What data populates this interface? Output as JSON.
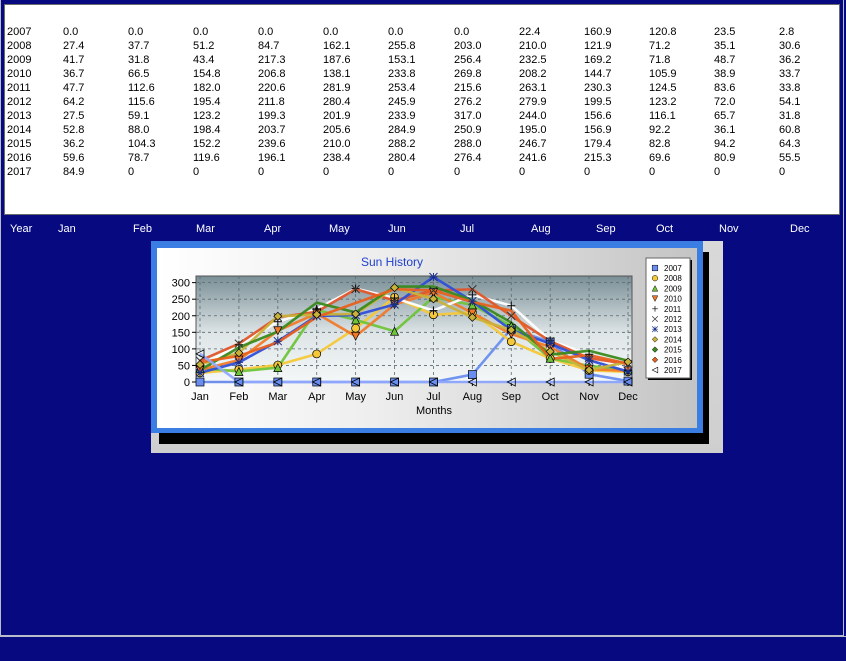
{
  "table": {
    "rows": [
      {
        "year": "2007",
        "values": [
          "0.0",
          "0.0",
          "0.0",
          "0.0",
          "0.0",
          "0.0",
          "0.0",
          "22.4",
          "160.9",
          "120.8",
          "23.5",
          "2.8"
        ]
      },
      {
        "year": "2008",
        "values": [
          "27.4",
          "37.7",
          "51.2",
          "84.7",
          "162.1",
          "255.8",
          "203.0",
          "210.0",
          "121.9",
          "71.2",
          "35.1",
          "30.6"
        ]
      },
      {
        "year": "2009",
        "values": [
          "41.7",
          "31.8",
          "43.4",
          "217.3",
          "187.6",
          "153.1",
          "256.4",
          "232.5",
          "169.2",
          "71.8",
          "48.7",
          "36.2"
        ]
      },
      {
        "year": "2010",
        "values": [
          "36.7",
          "66.5",
          "154.8",
          "206.8",
          "138.1",
          "233.8",
          "269.8",
          "208.2",
          "144.7",
          "105.9",
          "38.9",
          "33.7"
        ]
      },
      {
        "year": "2011",
        "values": [
          "47.7",
          "112.6",
          "182.0",
          "220.6",
          "281.9",
          "253.4",
          "215.6",
          "263.1",
          "230.3",
          "124.5",
          "83.6",
          "33.8"
        ]
      },
      {
        "year": "2012",
        "values": [
          "64.2",
          "115.6",
          "195.4",
          "211.8",
          "280.4",
          "245.9",
          "276.2",
          "279.9",
          "199.5",
          "123.2",
          "72.0",
          "54.1"
        ]
      },
      {
        "year": "2013",
        "values": [
          "27.5",
          "59.1",
          "123.2",
          "199.3",
          "201.9",
          "233.9",
          "317.0",
          "244.0",
          "156.6",
          "116.1",
          "65.7",
          "31.8"
        ]
      },
      {
        "year": "2014",
        "values": [
          "52.8",
          "88.0",
          "198.4",
          "203.7",
          "205.6",
          "284.9",
          "250.9",
          "195.0",
          "156.9",
          "92.2",
          "36.1",
          "60.8"
        ]
      },
      {
        "year": "2015",
        "values": [
          "36.2",
          "104.3",
          "152.2",
          "239.6",
          "210.0",
          "288.2",
          "288.0",
          "246.7",
          "179.4",
          "82.8",
          "94.2",
          "64.3"
        ]
      },
      {
        "year": "2016",
        "values": [
          "59.6",
          "78.7",
          "119.6",
          "196.1",
          "238.4",
          "280.4",
          "276.4",
          "241.6",
          "215.3",
          "69.6",
          "80.9",
          "55.5"
        ]
      },
      {
        "year": "2017",
        "values": [
          "84.9",
          "0",
          "0",
          "0",
          "0",
          "0",
          "0",
          "0",
          "0",
          "0",
          "0",
          "0"
        ]
      }
    ]
  },
  "header": {
    "year": "Year",
    "months": [
      "Jan",
      "Feb",
      "Mar",
      "Apr",
      "May",
      "Jun",
      "Jul",
      "Aug",
      "Sep",
      "Oct",
      "Nov",
      "Dec"
    ]
  },
  "chart_data": {
    "type": "line",
    "title": "Sun History",
    "xlabel": "Months",
    "ylabel": "",
    "categories": [
      "Jan",
      "Feb",
      "Mar",
      "Apr",
      "May",
      "Jun",
      "Jul",
      "Aug",
      "Sep",
      "Oct",
      "Nov",
      "Dec"
    ],
    "ylim": [
      0,
      320
    ],
    "yticks": [
      0,
      50,
      100,
      150,
      200,
      250,
      300
    ],
    "grid": true,
    "legend_position": "right",
    "series": [
      {
        "name": "2007",
        "color": "#6a8ef0",
        "marker": "square",
        "values": [
          0.0,
          0.0,
          0.0,
          0.0,
          0.0,
          0.0,
          0.0,
          22.4,
          160.9,
          120.8,
          23.5,
          2.8
        ]
      },
      {
        "name": "2008",
        "color": "#f5c83a",
        "marker": "circle",
        "values": [
          27.4,
          37.7,
          51.2,
          84.7,
          162.1,
          255.8,
          203.0,
          210.0,
          121.9,
          71.2,
          35.1,
          30.6
        ]
      },
      {
        "name": "2009",
        "color": "#6fc43a",
        "marker": "triangle-up",
        "values": [
          41.7,
          31.8,
          43.4,
          217.3,
          187.6,
          153.1,
          256.4,
          232.5,
          169.2,
          71.8,
          48.7,
          36.2
        ]
      },
      {
        "name": "2010",
        "color": "#f07a2a",
        "marker": "triangle-down",
        "values": [
          36.7,
          66.5,
          154.8,
          206.8,
          138.1,
          233.8,
          269.8,
          208.2,
          144.7,
          105.9,
          38.9,
          33.7
        ]
      },
      {
        "name": "2011",
        "color": "#ffffff",
        "marker": "plus",
        "values": [
          47.7,
          112.6,
          182.0,
          220.6,
          281.9,
          253.4,
          215.6,
          263.1,
          230.3,
          124.5,
          83.6,
          33.8
        ]
      },
      {
        "name": "2012",
        "color": "#e0562a",
        "marker": "cross",
        "values": [
          64.2,
          115.6,
          195.4,
          211.8,
          280.4,
          245.9,
          276.2,
          279.9,
          199.5,
          123.2,
          72.0,
          54.1
        ]
      },
      {
        "name": "2013",
        "color": "#2f4fd8",
        "marker": "star",
        "values": [
          27.5,
          59.1,
          123.2,
          199.3,
          201.9,
          233.9,
          317.0,
          244.0,
          156.6,
          116.1,
          65.7,
          31.8
        ]
      },
      {
        "name": "2014",
        "color": "#c9b23a",
        "marker": "diamond",
        "values": [
          52.8,
          88.0,
          198.4,
          203.7,
          205.6,
          284.9,
          250.9,
          195.0,
          156.9,
          92.2,
          36.1,
          60.8
        ]
      },
      {
        "name": "2015",
        "color": "#3a8a1e",
        "marker": "none",
        "values": [
          36.2,
          104.3,
          152.2,
          239.6,
          210.0,
          288.2,
          288.0,
          246.7,
          179.4,
          82.8,
          94.2,
          64.3
        ]
      },
      {
        "name": "2016",
        "color": "#e8601e",
        "marker": "none",
        "values": [
          59.6,
          78.7,
          119.6,
          196.1,
          238.4,
          280.4,
          276.4,
          241.6,
          215.3,
          69.6,
          80.9,
          55.5
        ]
      },
      {
        "name": "2017",
        "color": "#8fa8ff",
        "marker": "triangle-left",
        "values": [
          84.9,
          0,
          0,
          0,
          0,
          0,
          0,
          0,
          0,
          0,
          0,
          0
        ]
      }
    ]
  }
}
